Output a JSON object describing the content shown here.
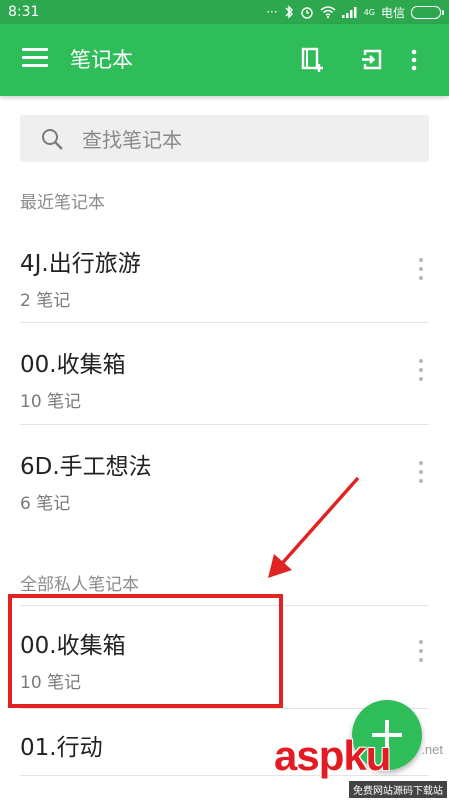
{
  "status_bar": {
    "time": "8:31",
    "network": "4G",
    "carrier": "电信"
  },
  "app_bar": {
    "title": "笔记本"
  },
  "search": {
    "placeholder": "查找笔记本"
  },
  "sections": {
    "recent": "最近笔记本",
    "all_private": "全部私人笔记本"
  },
  "recent_notebooks": [
    {
      "title": "4J.出行旅游",
      "count": "2 笔记"
    },
    {
      "title": "00.收集箱",
      "count": "10 笔记"
    },
    {
      "title": "6D.手工想法",
      "count": "6 笔记"
    }
  ],
  "all_notebooks": [
    {
      "title": "00.收集箱",
      "count": "10 笔记"
    },
    {
      "title": "01.行动"
    }
  ],
  "watermark": {
    "main": "aspku",
    "domain": ".net",
    "sub": "免费网站源码下载站"
  },
  "colors": {
    "appbar": "#2ebd59",
    "statusbar": "#2ea84f",
    "highlight": "#e02424"
  }
}
